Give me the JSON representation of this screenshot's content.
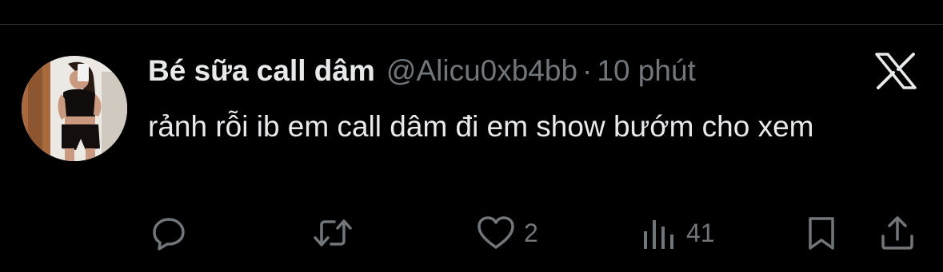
{
  "tweet": {
    "author": {
      "display_name": "Bé sữa call dâm",
      "handle": "@Alicu0xb4bb",
      "avatar": "avatar"
    },
    "separator": "·",
    "time": "10 phút",
    "text": "rảnh rỗi ib em call dâm đi em show bướm cho xem",
    "platform_icon": "x-logo-icon"
  },
  "actions": {
    "reply": {
      "icon": "reply-icon",
      "count": ""
    },
    "retweet": {
      "icon": "retweet-icon",
      "count": ""
    },
    "like": {
      "icon": "heart-icon",
      "count": "2"
    },
    "views": {
      "icon": "views-icon",
      "count": "41"
    },
    "bookmark": {
      "icon": "bookmark-icon",
      "count": ""
    },
    "share": {
      "icon": "share-icon",
      "count": ""
    }
  },
  "colors": {
    "background": "#000000",
    "text_primary": "#e7e9ea",
    "text_secondary": "#71767b",
    "divider": "#2f3336"
  }
}
